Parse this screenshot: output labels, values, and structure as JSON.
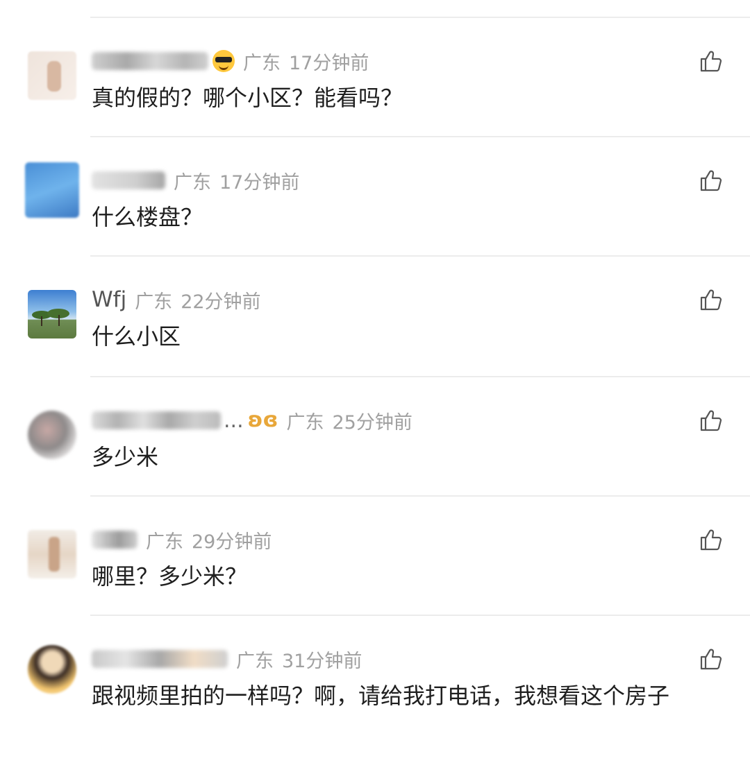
{
  "comments": [
    {
      "username": "",
      "badge": "sunglasses-emoji",
      "location": "广东",
      "time": "17分钟前",
      "content": "真的假的？哪个小区？能看吗？"
    },
    {
      "username": "",
      "badge": "",
      "location": "广东",
      "time": "17分钟前",
      "content": "什么楼盘？"
    },
    {
      "username": "Wfj",
      "badge": "",
      "location": "广东",
      "time": "22分钟前",
      "content": "什么小区"
    },
    {
      "username": "...",
      "badge": "ribbon",
      "location": "广东",
      "time": "25分钟前",
      "content": "多少米"
    },
    {
      "username": "",
      "badge": "",
      "location": "广东",
      "time": "29分钟前",
      "content": "哪里？多少米？"
    },
    {
      "username": "",
      "badge": "",
      "location": "广东",
      "time": "31分钟前",
      "content": "跟视频里拍的一样吗？啊，请给我打电话，我想看这个房子"
    }
  ],
  "icons": {
    "like": "thumbs-up-icon",
    "ribbon_symbol": "ʚɞ"
  },
  "colors": {
    "meta_text": "#a0a0a0",
    "divider": "#ececec",
    "ribbon_badge": "#e8a73a"
  }
}
